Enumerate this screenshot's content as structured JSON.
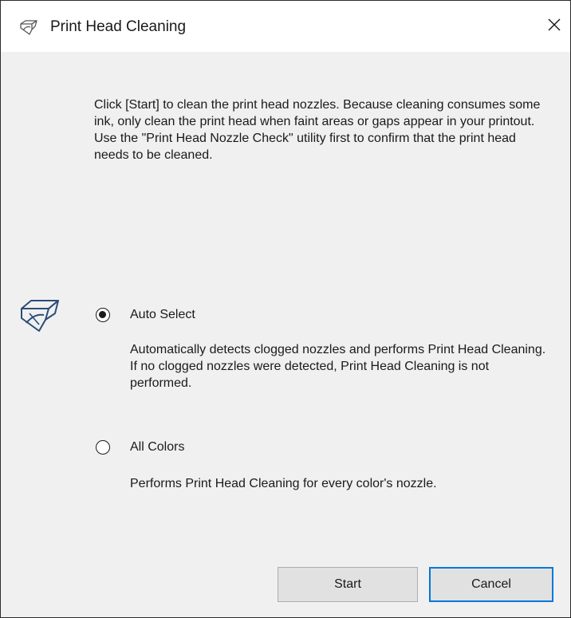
{
  "window": {
    "title": "Print Head Cleaning",
    "title_icon": "print-head-cleaning-icon",
    "close_icon": "close-icon"
  },
  "intro_text": "Click [Start] to clean the print head nozzles. Because cleaning consumes some ink, only clean the print head when faint areas or gaps appear in your printout. Use the \"Print Head Nozzle Check\" utility first to confirm that the print head needs to be cleaned.",
  "cleaning_mode_icon": "print-head-cleaning-icon",
  "options": [
    {
      "label": "Auto Select",
      "selected": true,
      "description_lines": [
        "Automatically detects clogged nozzles and performs Print Head Cleaning.",
        "If no clogged nozzles were detected, Print Head Cleaning is not performed."
      ]
    },
    {
      "label": "All Colors",
      "selected": false,
      "description_lines": [
        "Performs Print Head Cleaning for every color's nozzle."
      ]
    }
  ],
  "buttons": {
    "start": "Start",
    "cancel": "Cancel"
  },
  "colors": {
    "focus_border": "#0078d7",
    "dialog_background": "#f0f0f0"
  }
}
